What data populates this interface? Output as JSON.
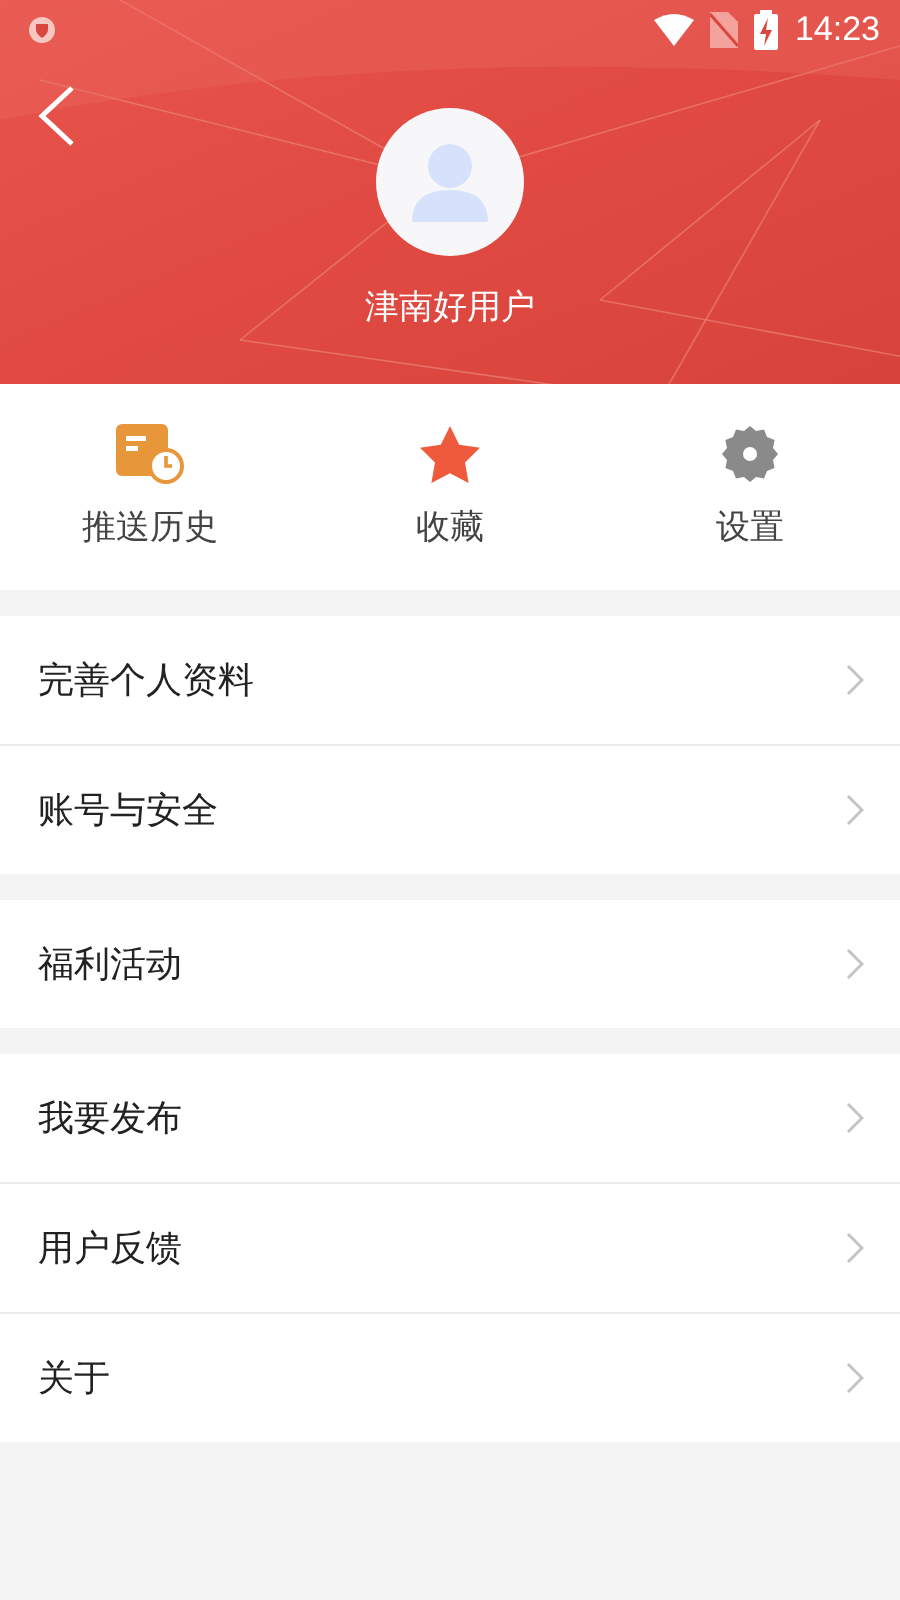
{
  "status_bar": {
    "time": "14:23"
  },
  "profile": {
    "username": "津南好用户"
  },
  "quick_actions": [
    {
      "kind": "history",
      "label": "推送历史"
    },
    {
      "kind": "favorites",
      "label": "收藏"
    },
    {
      "kind": "settings",
      "label": "设置"
    }
  ],
  "menu_groups": [
    {
      "items": [
        "完善个人资料",
        "账号与安全"
      ]
    },
    {
      "items": [
        "福利活动"
      ]
    },
    {
      "items": [
        "我要发布",
        "用户反馈",
        "关于"
      ]
    }
  ]
}
